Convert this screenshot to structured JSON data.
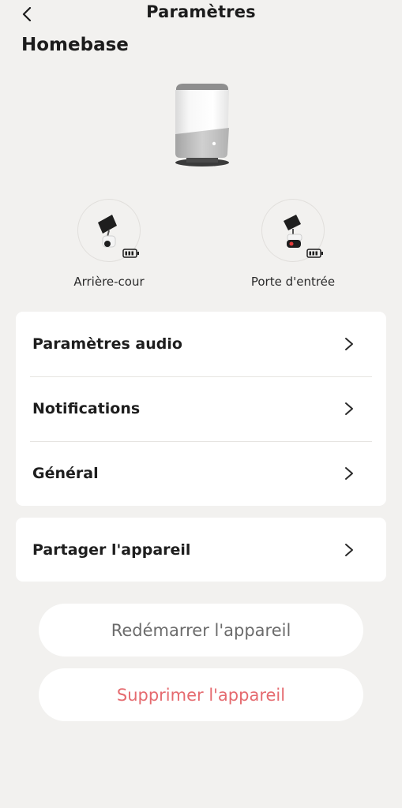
{
  "header": {
    "title": "Paramètres",
    "back_icon": "chevron-left-icon"
  },
  "device": {
    "name": "Homebase",
    "image_icon": "homebase-hub-image"
  },
  "cameras": [
    {
      "label": "Arrière-cour",
      "icon": "solar-camera-icon",
      "battery_icon": "battery-icon"
    },
    {
      "label": "Porte d'entrée",
      "icon": "solar-camera-icon",
      "battery_icon": "battery-icon"
    }
  ],
  "settings_menu": [
    {
      "label": "Paramètres audio"
    },
    {
      "label": "Notifications"
    },
    {
      "label": "Général"
    }
  ],
  "share_menu": [
    {
      "label": "Partager l'appareil"
    }
  ],
  "actions": {
    "restart_label": "Redémarrer l'appareil",
    "delete_label": "Supprimer l'appareil"
  },
  "colors": {
    "background": "#f2f1ef",
    "card": "#ffffff",
    "delete_text": "#e56a6f",
    "restart_text": "#6b6b6b"
  }
}
